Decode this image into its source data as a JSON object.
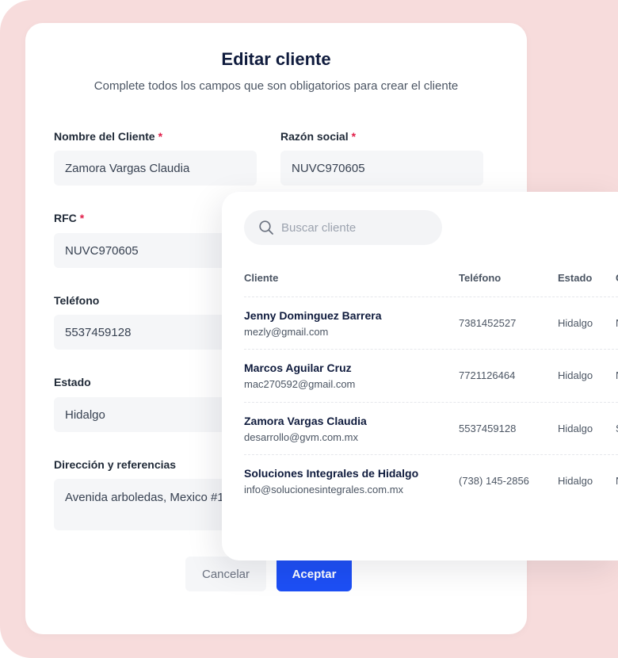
{
  "form": {
    "title": "Editar cliente",
    "subtitle": "Complete todos los campos que son obligatorios para crear el cliente",
    "required_mark": "*",
    "fields": {
      "nombre": {
        "label": "Nombre del Cliente",
        "value": "Zamora Vargas Claudia"
      },
      "razon": {
        "label": "Razón social",
        "value": "NUVC970605"
      },
      "rfc": {
        "label": "RFC",
        "value": "NUVC970605"
      },
      "telefono": {
        "label": "Teléfono",
        "value": "5537459128"
      },
      "estado": {
        "label": "Estado",
        "value": "Hidalgo"
      },
      "direccion": {
        "label": "Dirección y referencias",
        "value": "Avenida arboledas, Mexico #1"
      }
    },
    "cancel_label": "Cancelar",
    "accept_label": "Aceptar"
  },
  "client_list": {
    "search_placeholder": "Buscar cliente",
    "columns": [
      "Cliente",
      "Teléfono",
      "Estado",
      "C"
    ],
    "rows": [
      {
        "name": "Jenny Dominguez Barrera",
        "email": "mezly@gmail.com",
        "phone": "7381452527",
        "state": "Hidalgo",
        "extra": "N"
      },
      {
        "name": "Marcos Aguilar Cruz",
        "email": "mac270592@gmail.com",
        "phone": "7721126464",
        "state": "Hidalgo",
        "extra": "N"
      },
      {
        "name": "Zamora Vargas Claudia",
        "email": "desarrollo@gvm.com.mx",
        "phone": "5537459128",
        "state": "Hidalgo",
        "extra": "S"
      },
      {
        "name": "Soluciones Integrales de Hidalgo",
        "email": "info@solucionesintegrales.com.mx",
        "phone": "(738) 145-2856",
        "state": "Hidalgo",
        "extra": "N"
      }
    ]
  },
  "colors": {
    "background": "#f7dcdc",
    "accent": "#1d4ff5",
    "required": "#e11d48"
  }
}
